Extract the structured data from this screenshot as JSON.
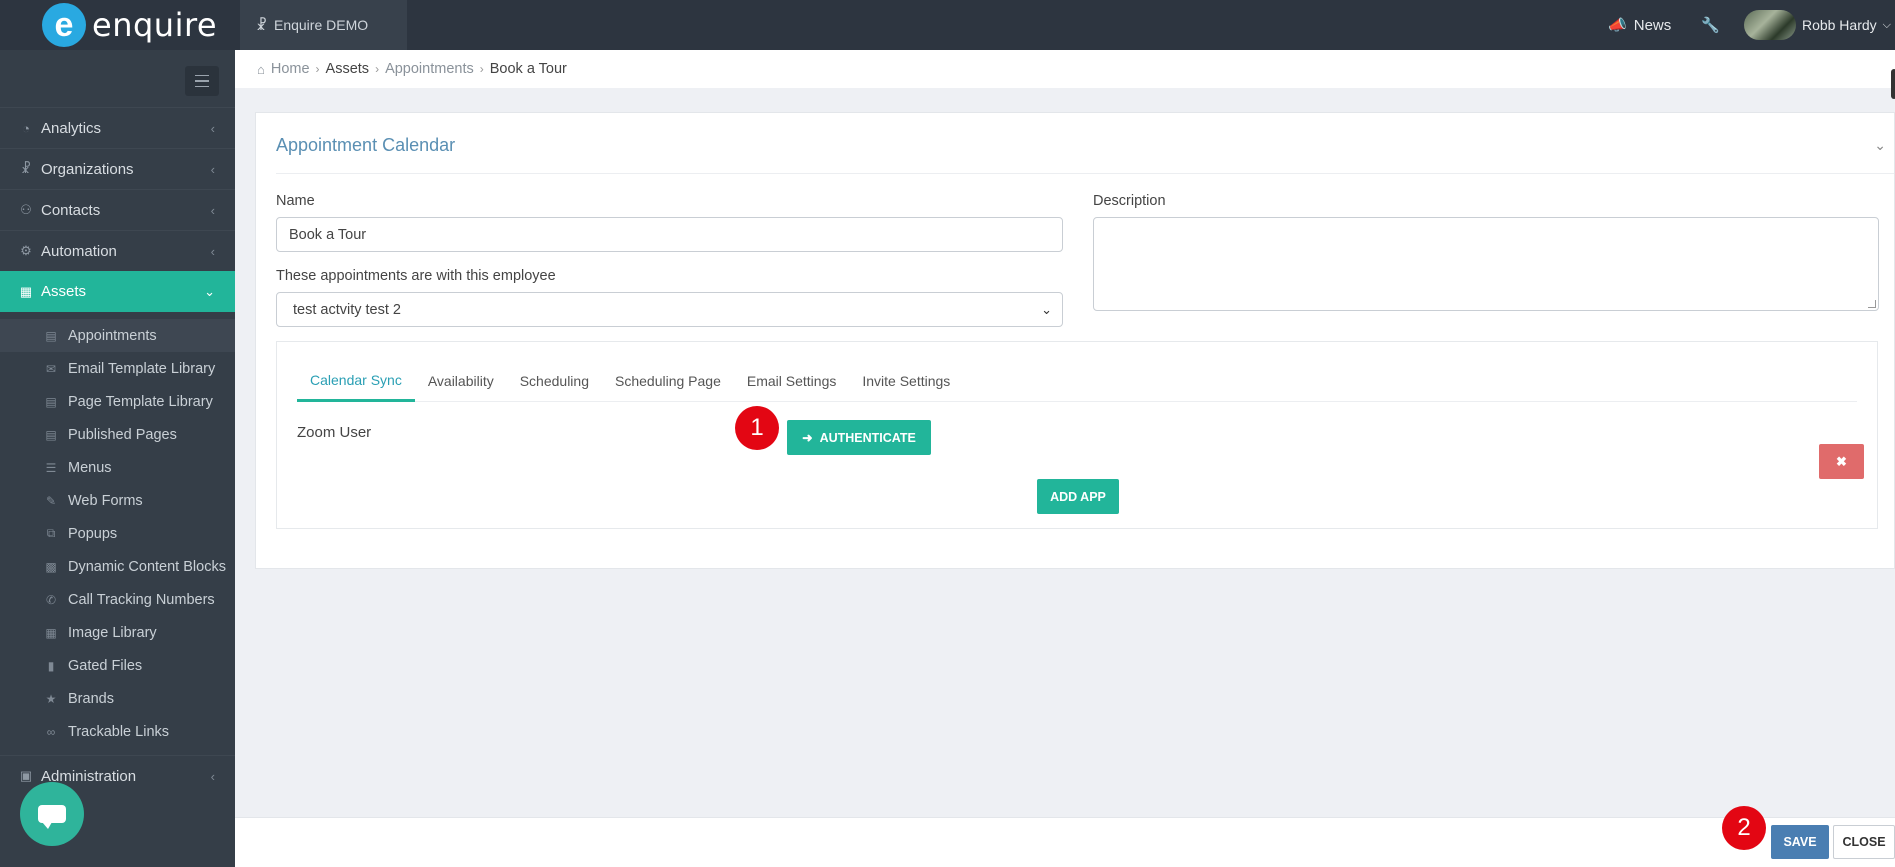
{
  "brand": {
    "logo_letter": "e",
    "name": "enquire"
  },
  "topbar": {
    "org_name": "Enquire DEMO",
    "news_label": "News",
    "user_name": "Robb Hardy",
    "icons": [
      "sitemap-icon",
      "megaphone-icon",
      "wrench-icon",
      "chevron-down-icon"
    ]
  },
  "sidebar": {
    "main_items": [
      {
        "label": "Analytics",
        "icon": "dashboard-icon"
      },
      {
        "label": "Organizations",
        "icon": "sitemap-icon"
      },
      {
        "label": "Contacts",
        "icon": "users-icon"
      },
      {
        "label": "Automation",
        "icon": "gears-icon"
      },
      {
        "label": "Assets",
        "icon": "grid-icon",
        "active": true
      }
    ],
    "sub_items": [
      {
        "label": "Appointments",
        "icon": "calendar-icon",
        "current": true
      },
      {
        "label": "Email Template Library",
        "icon": "envelope-icon"
      },
      {
        "label": "Page Template Library",
        "icon": "page-icon"
      },
      {
        "label": "Published Pages",
        "icon": "page-icon"
      },
      {
        "label": "Menus",
        "icon": "list-icon"
      },
      {
        "label": "Web Forms",
        "icon": "edit-icon"
      },
      {
        "label": "Popups",
        "icon": "popup-icon"
      },
      {
        "label": "Dynamic Content Blocks",
        "icon": "blocks-icon"
      },
      {
        "label": "Call Tracking Numbers",
        "icon": "phone-icon"
      },
      {
        "label": "Image Library",
        "icon": "image-icon"
      },
      {
        "label": "Gated Files",
        "icon": "file-icon"
      },
      {
        "label": "Brands",
        "icon": "star-icon"
      },
      {
        "label": "Trackable Links",
        "icon": "link-icon"
      }
    ],
    "admin_label": "Administration"
  },
  "breadcrumb": [
    "Home",
    "Assets",
    "Appointments",
    "Book a Tour"
  ],
  "card": {
    "title": "Appointment Calendar",
    "name_label": "Name",
    "name_value": "Book a Tour",
    "employee_label": "These appointments are with this employee",
    "employee_value": "test actvity test 2",
    "description_label": "Description",
    "description_value": "",
    "tabs": [
      "Calendar Sync",
      "Availability",
      "Scheduling",
      "Scheduling Page",
      "Email Settings",
      "Invite Settings"
    ],
    "active_tab": "Calendar Sync",
    "zoom_user_label": "Zoom User",
    "authenticate_label": "AUTHENTICATE",
    "add_app_label": "ADD APP",
    "delete_label": "✖"
  },
  "markers": [
    "1",
    "2"
  ],
  "footer": {
    "save_label": "SAVE",
    "close_label": "CLOSE"
  },
  "colors": {
    "accent": "#22b59a",
    "topbar": "#2d3540",
    "sidebar": "#353e48",
    "save": "#4a7eb2",
    "delete": "#e06b6b",
    "marker": "#e30613",
    "title": "#5a8fb3"
  }
}
